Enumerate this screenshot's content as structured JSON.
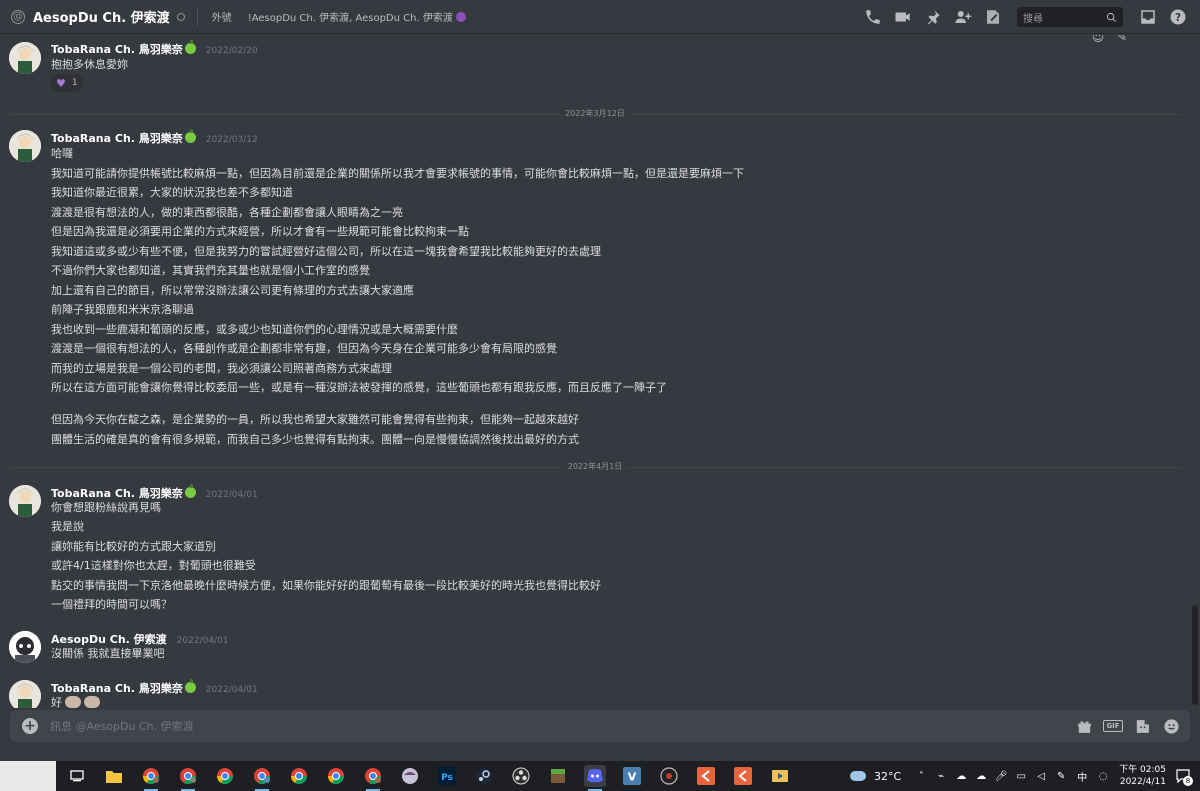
{
  "header": {
    "channel_name": "AesopDu Ch. 伊索渡",
    "nickname_label": "外號",
    "topic": "!AesopDu Ch. 伊索渡, AesopDu Ch. 伊索渡",
    "search_placeholder": "搜尋"
  },
  "messages": [
    {
      "author": "TobaRana Ch. 鳥羽樂奈",
      "timestamp": "2022/02/20",
      "lines": [
        "抱抱多休息愛妳"
      ],
      "reaction": {
        "emoji": "heart",
        "count": "1"
      }
    },
    {
      "divider": "2022年3月12日"
    },
    {
      "author": "TobaRana Ch. 鳥羽樂奈",
      "timestamp": "2022/03/12",
      "lines": [
        "哈囉",
        "我知道可能請你提供帳號比較麻煩一點，但因為目前還是企業的關係所以我才會要求帳號的事情，可能你會比較麻煩一點，但是還是要麻煩一下",
        "我知道你最近很累，大家的狀況我也差不多都知道",
        "渡渡是很有想法的人，做的東西都很酷，各種企劃都會讓人眼睛為之一亮",
        "但是因為我還是必須要用企業的方式來經營，所以才會有一些規範可能會比較拘束一點",
        "我知道這或多或少有些不便，但是我努力的嘗試經營好這個公司，所以在這一塊我會希望我比較能夠更好的去處理",
        "不過你們大家也都知道，其實我們充其量也就是個小工作室的感覺",
        "加上還有自己的節目，所以常常沒辦法讓公司更有條理的方式去讓大家適應",
        "前陣子我跟鹿和米米京洛聊過",
        "我也收到一些鹿凝和葡頭的反應，或多或少也知道你們的心理情況或是大概需要什麼",
        "渡渡是一個很有想法的人，各種創作或是企劃都非常有趣，但因為今天身在企業可能多少會有局限的感覺",
        "而我的立場是我是一個公司的老闆，我必須讓公司照著商務方式來處理",
        "所以在這方面可能會讓你覺得比較委屈一些，或是有一種沒辦法被發揮的感覺，這些葡頭也都有跟我反應，而且反應了一陣子了",
        "但因為今天你在靛之森，是企業勢的一員，所以我也希望大家雖然可能會覺得有些拘束，但能夠一起越來越好",
        "團體生活的確是真的會有很多規範，而我自己多少也覺得有點拘束。團體一向是慢慢協調然後找出最好的方式"
      ]
    },
    {
      "divider": "2022年4月1日"
    },
    {
      "author": "TobaRana Ch. 鳥羽樂奈",
      "timestamp": "2022/04/01",
      "lines": [
        "你會想跟粉絲說再見嗎",
        "我是說",
        "讓妳能有比較好的方式跟大家道別",
        "或許4/1這樣對你也太趕，對葡頭也很難受",
        "點交的事情我問一下京洛他最晚什麼時候方便，如果你能好好的跟葡萄有最後一段比較美好的時光我也覺得比較好",
        "一個禮拜的時間可以嗎？"
      ]
    },
    {
      "author": "AesopDu Ch. 伊索渡",
      "timestamp": "2022/04/01",
      "lines": [
        "沒關係 我就直接畢業吧"
      ]
    },
    {
      "author": "TobaRana Ch. 鳥羽樂奈",
      "timestamp": "2022/04/01",
      "lines": [
        "好"
      ]
    }
  ],
  "input": {
    "placeholder": "訊息 @AesopDu Ch. 伊索渡",
    "gif_label": "GIF"
  },
  "taskbar": {
    "temperature": "32°C",
    "ime": "中",
    "time": "下午 02:05",
    "date": "2022/4/11",
    "notification_count": "8"
  },
  "colors": {
    "background": "#36393f",
    "input": "#40444b",
    "taskbar": "#1d1f22",
    "heart_reaction": "#a57ad1"
  }
}
